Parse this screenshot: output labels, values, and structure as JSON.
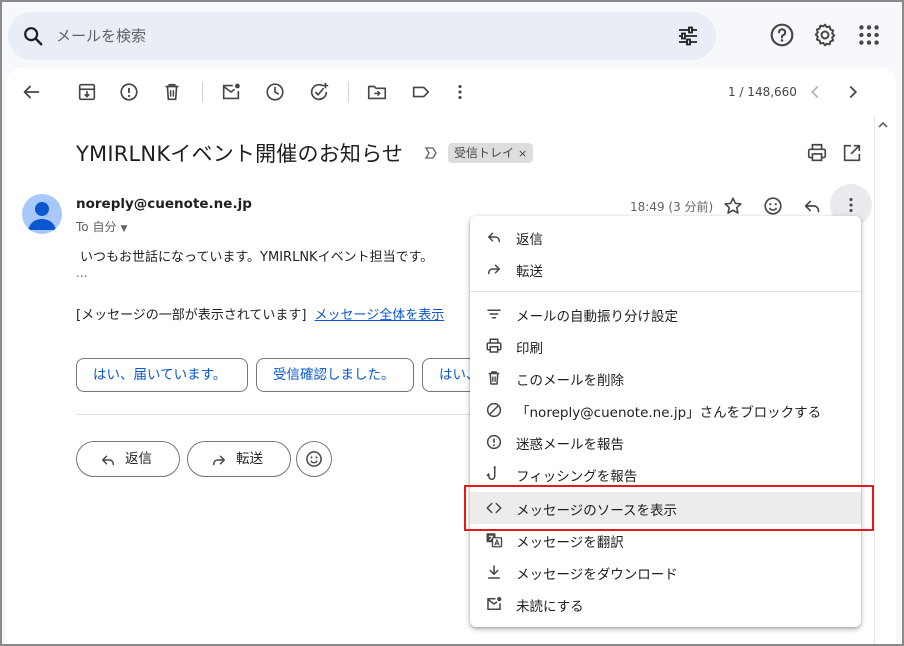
{
  "search": {
    "placeholder": "メールを検索"
  },
  "toolbar": {
    "pager": "1 / 148,660"
  },
  "message": {
    "subject": "YMIRLNKイベント開催のお知らせ",
    "label_chip": "受信トレイ",
    "label_chip_close": "×",
    "sender": "noreply@cuenote.ne.jp",
    "to": "To 自分",
    "to_caret": "▼",
    "time": "18:49 (3 分前)",
    "body_line": "いつもお世話になっています。YMIRLNKイベント担当です。",
    "ellipsis": "...",
    "partial_text": "[メッセージの一部が表示されています]",
    "show_all_link": "メッセージ全体を表示"
  },
  "smart_replies": [
    "はい、届いています。",
    "受信確認しました。",
    "はい、"
  ],
  "actions": {
    "reply": "返信",
    "forward": "転送"
  },
  "menu": {
    "items": [
      {
        "label": "返信",
        "icon": "reply-icon"
      },
      {
        "label": "転送",
        "icon": "forward-icon"
      },
      {
        "label": "メールの自動振り分け設定",
        "icon": "filter-icon"
      },
      {
        "label": "印刷",
        "icon": "print-icon"
      },
      {
        "label": "このメールを削除",
        "icon": "trash-icon"
      },
      {
        "label": "「noreply@cuenote.ne.jp」さんをブロックする",
        "icon": "block-icon"
      },
      {
        "label": "迷惑メールを報告",
        "icon": "spam-icon"
      },
      {
        "label": "フィッシングを報告",
        "icon": "phishing-hook-icon"
      },
      {
        "label": "メッセージのソースを表示",
        "icon": "code-icon"
      },
      {
        "label": "メッセージを翻訳",
        "icon": "translate-icon"
      },
      {
        "label": "メッセージをダウンロード",
        "icon": "download-icon"
      },
      {
        "label": "未読にする",
        "icon": "mark-unread-icon"
      }
    ]
  },
  "colors": {
    "highlight_box": "#e01c1c",
    "link": "#0b57d0",
    "search_bg": "#e9eef6"
  }
}
